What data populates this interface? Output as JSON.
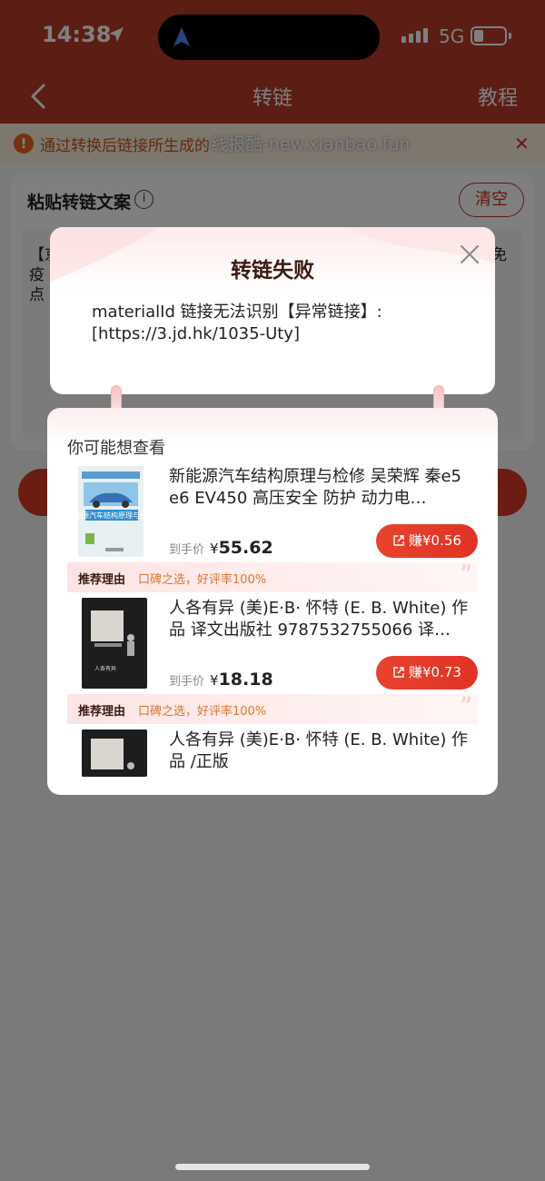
{
  "status": {
    "time": "14:38",
    "network": "5G"
  },
  "nav": {
    "title": "转链",
    "help": "教程"
  },
  "notice": {
    "text": "通过转换后链接所生成的",
    "watermark": "线报酷-new.xianbao.fun"
  },
  "paste": {
    "title": "粘贴转链文案",
    "clear": "清空",
    "lines": [
      "【京",
      "免",
      "疫",
      "点"
    ]
  },
  "modal": {
    "title": "转链失败",
    "message": "materialId 链接无法识别【异常链接】: [https://3.jd.hk/1035-Uty]"
  },
  "recommend": {
    "title": "你可能想查看",
    "price_label": "到手价",
    "currency": "¥",
    "reason_label": "推荐理由",
    "products": [
      {
        "title": "新能源汽车结构原理与检修 吴荣辉 秦e5 e6 EV450 高压安全 防护 动力电…",
        "price": "55.62",
        "earn": "赚¥0.56",
        "reason": "口碑之选，好评率100%",
        "cover_text": "新能源汽车结构原理与检修"
      },
      {
        "title": "人各有异 (美)E·B· 怀特 (E. B. White) 作品 译文出版社 9787532755066 译…",
        "price": "18.18",
        "earn": "赚¥0.73",
        "reason": "口碑之选，好评率100%",
        "cover_text": "人各有异"
      },
      {
        "title": "人各有异 (美)E·B· 怀特 (E. B. White) 作品 /正版"
      }
    ]
  }
}
